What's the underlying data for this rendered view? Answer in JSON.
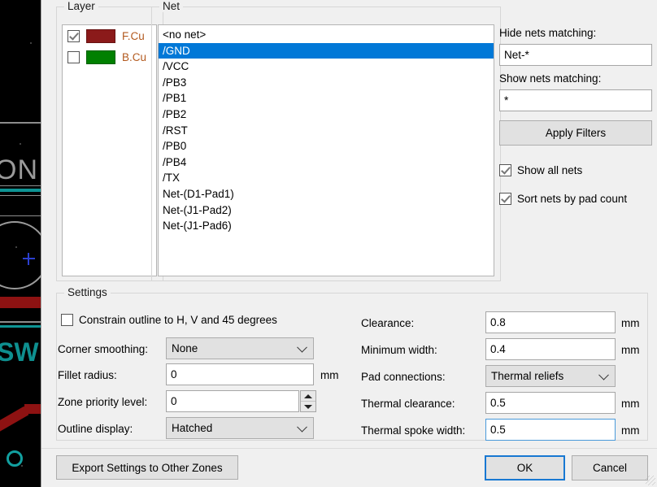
{
  "dialog": {
    "layer_group_title": "Layer",
    "net_group_title": "Net",
    "settings_group_title": "Settings"
  },
  "layers": [
    {
      "name": "F.Cu",
      "color": "#8b1a1a",
      "checked": true
    },
    {
      "name": "B.Cu",
      "color": "#008000",
      "checked": false
    }
  ],
  "nets": {
    "items": [
      "<no net>",
      "/GND",
      "/VCC",
      "/PB3",
      "/PB1",
      "/PB2",
      "/RST",
      "/PB0",
      "/PB4",
      "/TX",
      "Net-(D1-Pad1)",
      "Net-(J1-Pad2)",
      "Net-(J1-Pad6)"
    ],
    "selected_index": 1,
    "selection_color": "#0078d7"
  },
  "filters": {
    "hide_label": "Hide nets matching:",
    "hide_value": "Net-*",
    "show_label": "Show nets matching:",
    "show_value": "*",
    "apply_label": "Apply Filters",
    "show_all_nets_label": "Show all nets",
    "show_all_nets_checked": true,
    "sort_by_pad_count_label": "Sort nets by pad count",
    "sort_by_pad_count_checked": true
  },
  "settings": {
    "constrain_label": "Constrain outline to H, V and 45 degrees",
    "constrain_checked": false,
    "corner_smoothing_label": "Corner smoothing:",
    "corner_smoothing_value": "None",
    "fillet_radius_label": "Fillet radius:",
    "fillet_radius_value": "0",
    "fillet_radius_unit": "mm",
    "zone_priority_label": "Zone priority level:",
    "zone_priority_value": "0",
    "outline_display_label": "Outline display:",
    "outline_display_value": "Hatched",
    "clearance_label": "Clearance:",
    "clearance_value": "0.8",
    "clearance_unit": "mm",
    "minimum_width_label": "Minimum width:",
    "minimum_width_value": "0.4",
    "minimum_width_unit": "mm",
    "pad_connections_label": "Pad connections:",
    "pad_connections_value": "Thermal reliefs",
    "thermal_clearance_label": "Thermal clearance:",
    "thermal_clearance_value": "0.5",
    "thermal_clearance_unit": "mm",
    "thermal_spoke_label": "Thermal spoke width:",
    "thermal_spoke_value": "0.5",
    "thermal_spoke_unit": "mm"
  },
  "buttons": {
    "export_label": "Export Settings to Other Zones",
    "ok_label": "OK",
    "cancel_label": "Cancel"
  },
  "canvas": {
    "silk_text": "ON.",
    "teal_text": "SW"
  }
}
